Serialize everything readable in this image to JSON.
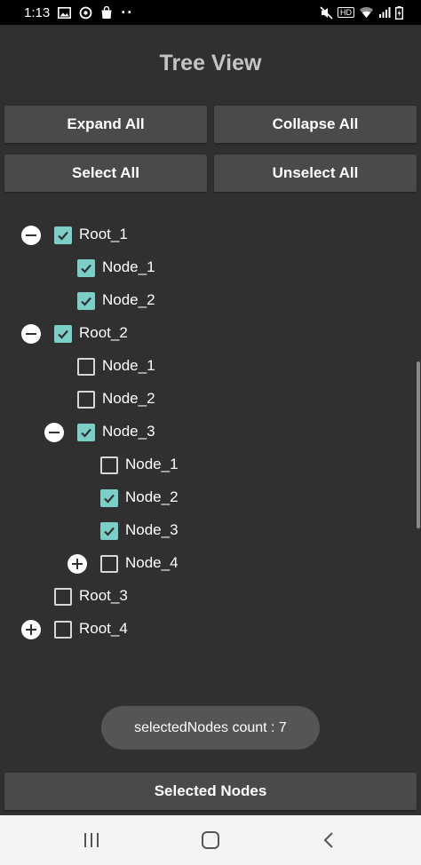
{
  "status_bar": {
    "time": "1:13",
    "left_icons": [
      "image-icon",
      "assistant-icon",
      "bag-icon",
      "more-dots-icon"
    ],
    "right_icons": [
      "mute-icon",
      "hd-icon",
      "wifi-icon",
      "signal-icon",
      "battery-charging-icon"
    ],
    "hd_label": "HD",
    "more_dots": "··"
  },
  "header": {
    "title": "Tree View"
  },
  "buttons": {
    "expand_all": "Expand All",
    "collapse_all": "Collapse All",
    "select_all": "Select All",
    "unselect_all": "Unselect All",
    "selected_nodes": "Selected Nodes"
  },
  "tree": {
    "rows": [
      {
        "label": "Root_1",
        "checked": true,
        "toggle": "collapse"
      },
      {
        "label": "Node_1",
        "checked": true,
        "toggle": null
      },
      {
        "label": "Node_2",
        "checked": true,
        "toggle": null
      },
      {
        "label": "Root_2",
        "checked": true,
        "toggle": "collapse"
      },
      {
        "label": "Node_1",
        "checked": false,
        "toggle": null
      },
      {
        "label": "Node_2",
        "checked": false,
        "toggle": null
      },
      {
        "label": "Node_3",
        "checked": true,
        "toggle": "collapse"
      },
      {
        "label": "Node_1",
        "checked": false,
        "toggle": null
      },
      {
        "label": "Node_2",
        "checked": true,
        "toggle": null
      },
      {
        "label": "Node_3",
        "checked": true,
        "toggle": null
      },
      {
        "label": "Node_4",
        "checked": false,
        "toggle": "expand"
      },
      {
        "label": "Root_3",
        "checked": false,
        "toggle": null
      },
      {
        "label": "Root_4",
        "checked": false,
        "toggle": "expand"
      }
    ]
  },
  "toast": {
    "text": "selectedNodes count : 7"
  },
  "nav_bar": {
    "icons": [
      "recents-icon",
      "home-icon",
      "back-icon"
    ]
  },
  "colors": {
    "background": "#303030",
    "button": "#4a4a4b",
    "checkbox_checked": "#7ccfc6",
    "title": "#c4c4c4"
  }
}
